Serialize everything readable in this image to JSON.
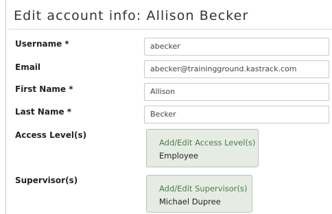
{
  "page": {
    "title": "Edit account info: Allison Becker"
  },
  "form": {
    "username": {
      "label": "Username *",
      "value": "abecker"
    },
    "email": {
      "label": "Email",
      "value": "abecker@trainingground.kastrack.com"
    },
    "first_name": {
      "label": "First Name *",
      "value": "Allison"
    },
    "last_name": {
      "label": "Last Name *",
      "value": "Becker"
    },
    "access_levels": {
      "label": "Access Level(s)",
      "link": "Add/Edit Access Level(s)",
      "value": "Employee"
    },
    "supervisors": {
      "label": "Supervisor(s)",
      "link": "Add/Edit Supervisor(s)",
      "value": "Michael Dupree"
    }
  },
  "colors": {
    "picker_bg": "#e6ece3",
    "link": "#4a7c4f",
    "border": "#c9c9c9"
  }
}
